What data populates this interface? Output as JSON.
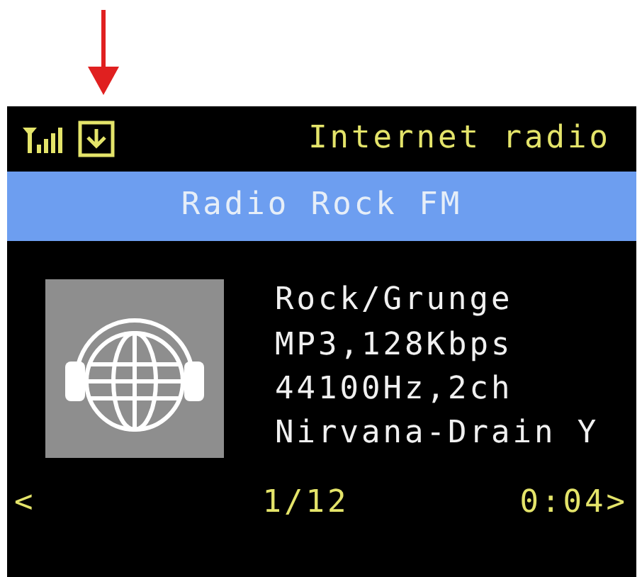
{
  "status_bar": {
    "title": "Internet radio"
  },
  "station": {
    "name": "Radio Rock FM"
  },
  "info_lines": [
    "Rock/Grunge",
    "MP3,128Kbps",
    "44100Hz,2ch",
    "Nirvana-Drain Y"
  ],
  "footer": {
    "prev": "<",
    "track": "1/12",
    "time": "0:04>"
  }
}
